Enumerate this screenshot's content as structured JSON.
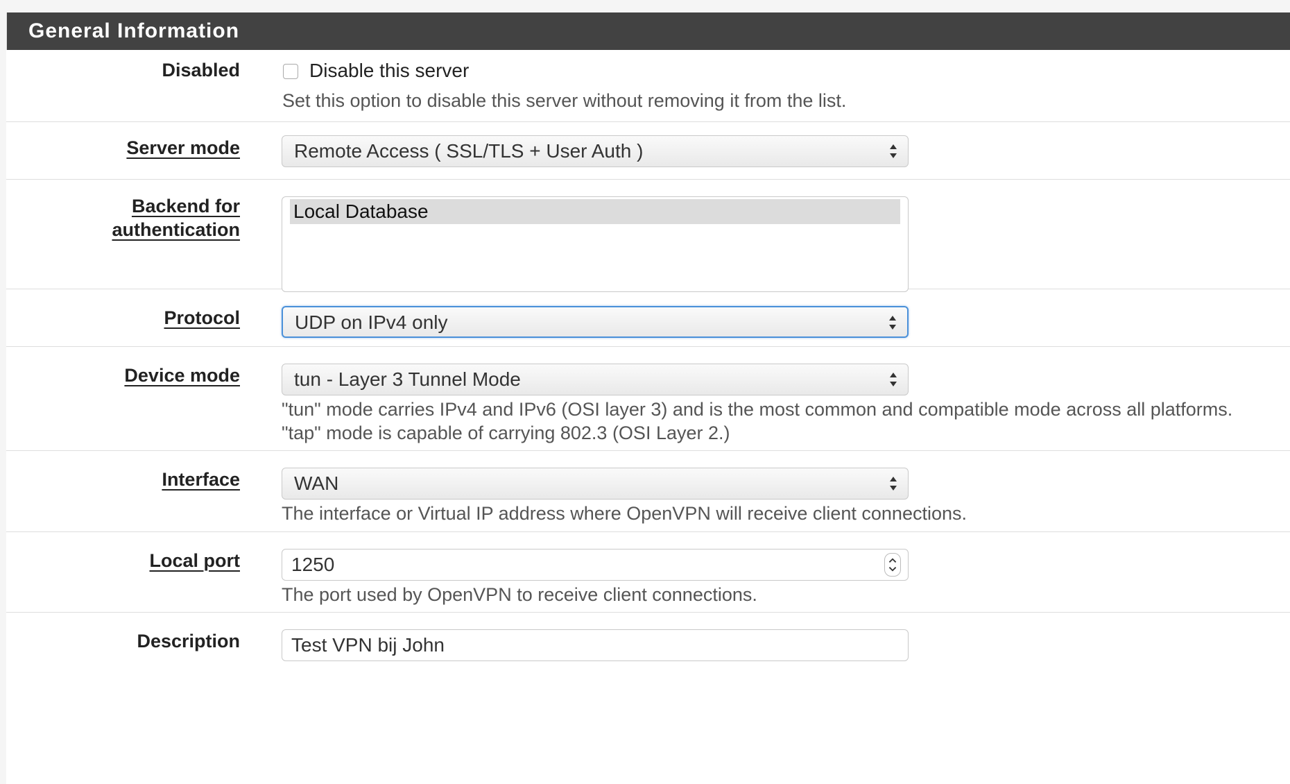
{
  "panel": {
    "title": "General Information"
  },
  "fields": {
    "disabled": {
      "label": "Disabled",
      "checkbox_label": "Disable this server",
      "checked": false,
      "help": "Set this option to disable this server without removing it from the list."
    },
    "server_mode": {
      "label": "Server mode",
      "value": "Remote Access ( SSL/TLS + User Auth )"
    },
    "backend_auth": {
      "label_line1": "Backend for",
      "label_line2": "authentication",
      "options": [
        "Local Database"
      ],
      "selected": "Local Database"
    },
    "protocol": {
      "label": "Protocol",
      "value": "UDP on IPv4 only"
    },
    "device_mode": {
      "label": "Device mode",
      "value": "tun - Layer 3 Tunnel Mode",
      "help_line1": "\"tun\" mode carries IPv4 and IPv6 (OSI layer 3) and is the most common and compatible mode across all platforms.",
      "help_line2": "\"tap\" mode is capable of carrying 802.3 (OSI Layer 2.)"
    },
    "interface": {
      "label": "Interface",
      "value": "WAN",
      "help": "The interface or Virtual IP address where OpenVPN will receive client connections."
    },
    "local_port": {
      "label": "Local port",
      "value": "1250",
      "help": "The port used by OpenVPN to receive client connections."
    },
    "description": {
      "label": "Description",
      "value": "Test VPN bij John"
    }
  },
  "icons": {
    "select": "select-arrows-icon",
    "spinner": "number-spinner-icon"
  },
  "colors": {
    "header_bg": "#424242",
    "header_text": "#ffffff",
    "focus_border": "#4a90d9"
  }
}
